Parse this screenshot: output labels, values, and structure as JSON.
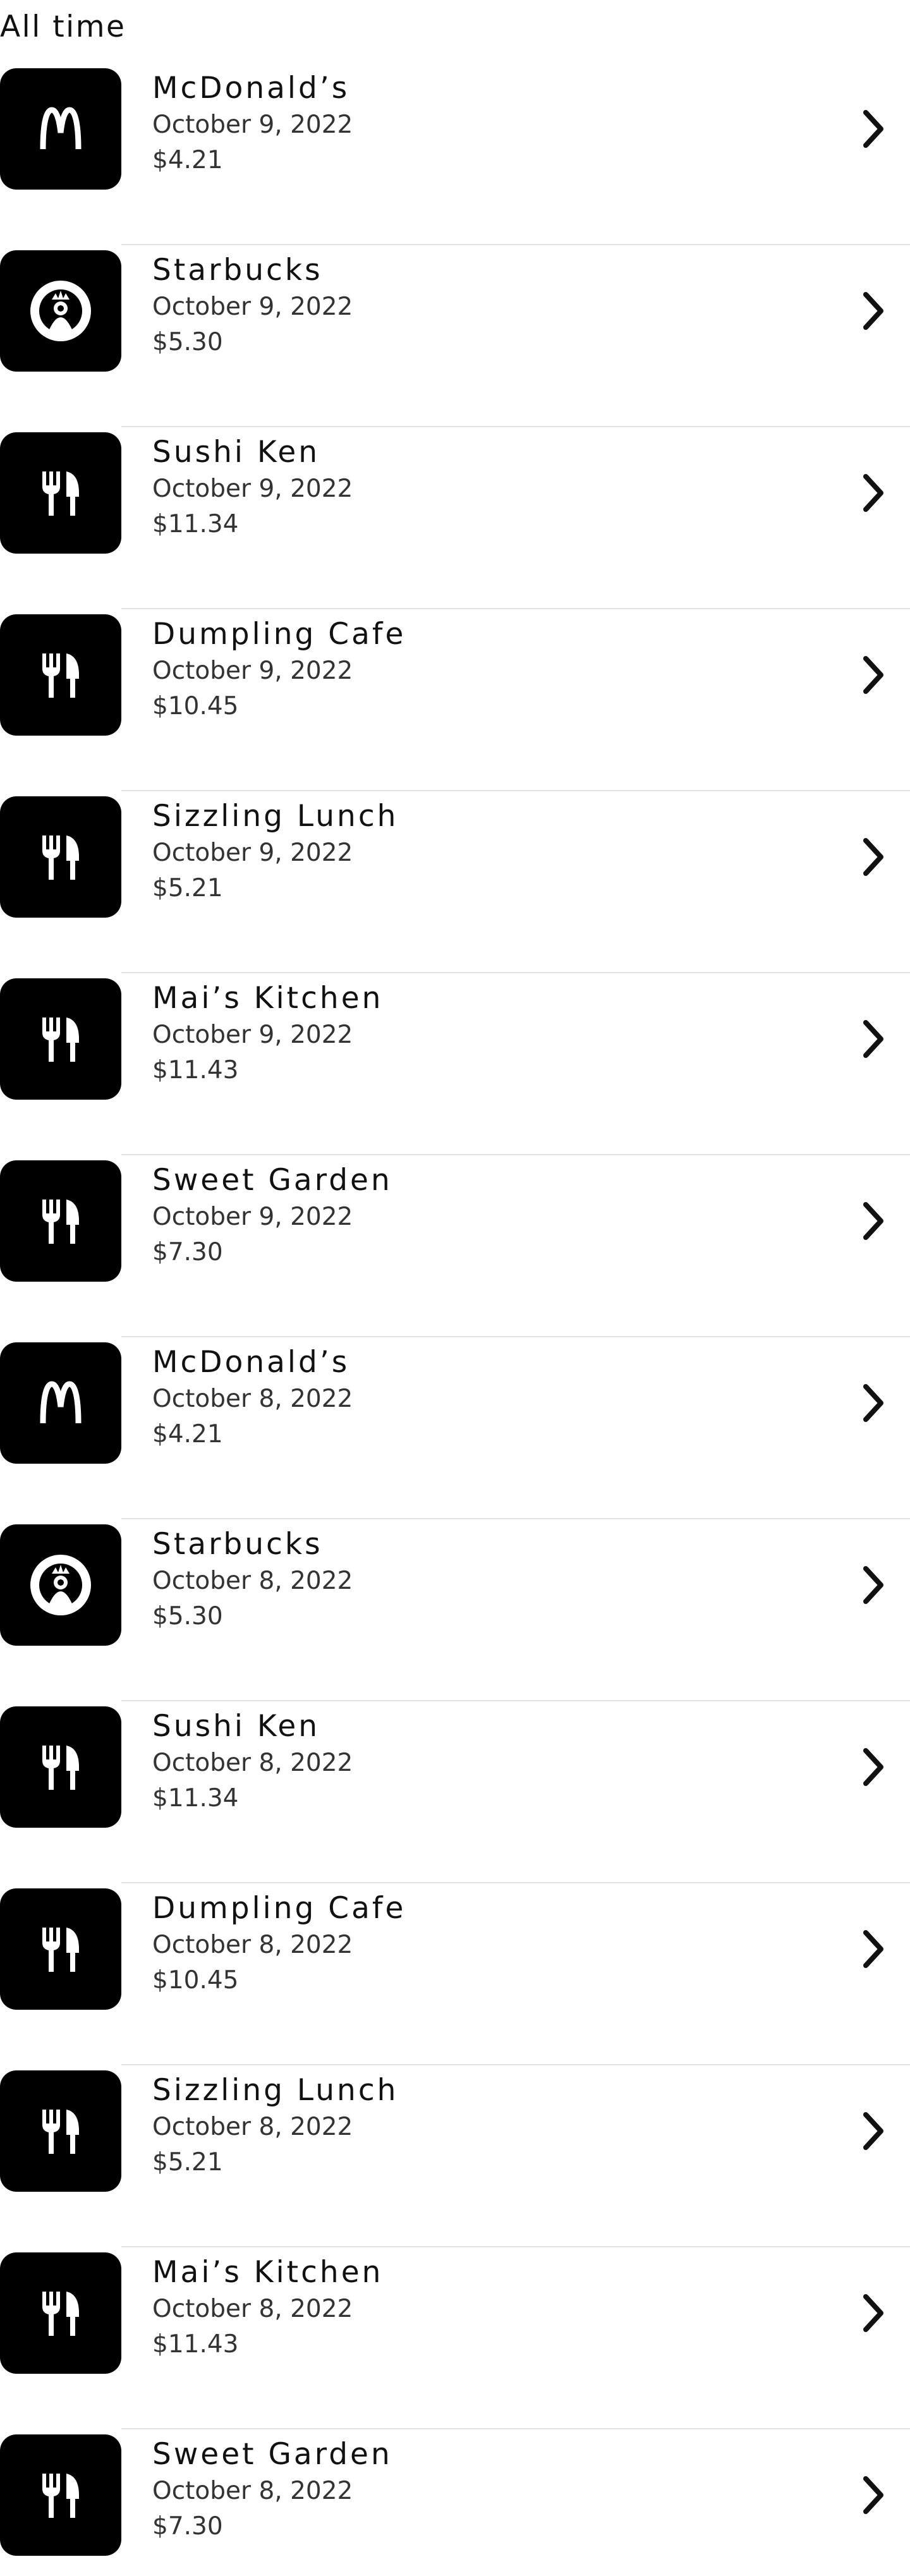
{
  "section_title": "All time",
  "transactions": [
    {
      "name": "McDonald’s",
      "date": "October 9, 2022",
      "amount": "$4.21",
      "icon": "mcdonalds-logo-icon"
    },
    {
      "name": "Starbucks",
      "date": "October 9, 2022",
      "amount": "$5.30",
      "icon": "starbucks-logo-icon"
    },
    {
      "name": "Sushi Ken",
      "date": "October 9, 2022",
      "amount": "$11.34",
      "icon": "restaurant-icon"
    },
    {
      "name": "Dumpling Cafe",
      "date": "October 9, 2022",
      "amount": "$10.45",
      "icon": "restaurant-icon"
    },
    {
      "name": "Sizzling Lunch",
      "date": "October 9, 2022",
      "amount": "$5.21",
      "icon": "restaurant-icon"
    },
    {
      "name": "Mai’s Kitchen",
      "date": "October 9, 2022",
      "amount": "$11.43",
      "icon": "restaurant-icon"
    },
    {
      "name": "Sweet Garden",
      "date": "October 9, 2022",
      "amount": "$7.30",
      "icon": "restaurant-icon"
    },
    {
      "name": "McDonald’s",
      "date": "October 8, 2022",
      "amount": "$4.21",
      "icon": "mcdonalds-logo-icon"
    },
    {
      "name": "Starbucks",
      "date": "October 8, 2022",
      "amount": "$5.30",
      "icon": "starbucks-logo-icon"
    },
    {
      "name": "Sushi Ken",
      "date": "October 8, 2022",
      "amount": "$11.34",
      "icon": "restaurant-icon"
    },
    {
      "name": "Dumpling Cafe",
      "date": "October 8, 2022",
      "amount": "$10.45",
      "icon": "restaurant-icon"
    },
    {
      "name": "Sizzling Lunch",
      "date": "October 8, 2022",
      "amount": "$5.21",
      "icon": "restaurant-icon"
    },
    {
      "name": "Mai’s Kitchen",
      "date": "October 8, 2022",
      "amount": "$11.43",
      "icon": "restaurant-icon"
    },
    {
      "name": "Sweet Garden",
      "date": "October 8, 2022",
      "amount": "$7.30",
      "icon": "restaurant-icon"
    }
  ],
  "colors": {
    "logo_background": "#000000",
    "divider": "#e4e4e4",
    "text": "#111111"
  }
}
